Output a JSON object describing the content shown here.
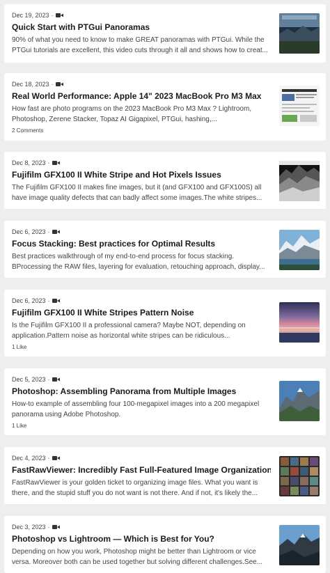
{
  "posts": [
    {
      "date": "Dec 19, 2023",
      "title": "Quick Start with PTGui Panoramas",
      "excerpt_line1": "90% of what you need to know to make GREAT panoramas with PTGui.  While the",
      "excerpt_line2": "PTGui tutorials are excellent, this video cuts through it all and shows how to creat...",
      "footer": ""
    },
    {
      "date": "Dec 18, 2023",
      "title": "Real World Performance: Apple 14\" 2023 MacBook Pro M3 Max",
      "excerpt_line1": "How fast are photo programs on the 2023 MacBook Pro M3 Max ?  Lightroom,",
      "excerpt_line2": "Photoshop, Zerene Stacker, Topaz AI Gigapixel, PTGui, hashing,...",
      "footer": "2 Comments"
    },
    {
      "date": "Dec 8, 2023",
      "title": "Fujifilm GFX100 II White Stripe and Hot Pixels Issues",
      "excerpt_line1": "The Fujifilm GFX100 II makes fine images, but it (and GFX100 and GFX100S) all",
      "excerpt_line2": "have   image quality defects that can badly affect some images.The white stripes...",
      "footer": ""
    },
    {
      "date": "Dec 6, 2023",
      "title": "Focus Stacking: Best practices for Optimal Results",
      "excerpt_line1": "Best practices walkthrough of my end-to-end process for focus stacking.",
      "excerpt_line2": "  BProcessing the RAW files, layering for evaluation, retouching approach, display...",
      "footer": ""
    },
    {
      "date": "Dec 6, 2023",
      "title": "Fujifilm GFX100 II White Stripes Pattern Noise",
      "excerpt_line1": "Is the Fujifilm GFX100 II  a professional camera?  Maybe NOT, depending on",
      "excerpt_line2": "application.Pattern noise  as horizontal white stripes can be ridiculous...",
      "footer": "1 Like"
    },
    {
      "date": "Dec 5, 2023",
      "title": "Photoshop: Assembling Panorama from Multiple Images",
      "excerpt_line1": "How-to example of assembling four 100-megapixel images into a 200 megapixel",
      "excerpt_line2": "panorama using Adobe Photoshop.",
      "footer": "1 Like"
    },
    {
      "date": "Dec 4, 2023",
      "title": "FastRawViewer: Incredibly Fast Full-Featured Image Organization",
      "excerpt_line1": "FastRawViewer is your golden ticket to organizing image files.  What you want is",
      "excerpt_line2": "there, and the stupid stuff you do not want is not there.  And if not, it's likely the...",
      "footer": ""
    },
    {
      "date": "Dec 3, 2023",
      "title": "Photoshop vs Lightroom — Which is Best for You?",
      "excerpt_line1": "Depending on how you work, Photoshop might be better than Lightroom or vice",
      "excerpt_line2": "versa.  Moreover both can be used together but solving different challenges.See...",
      "footer": ""
    }
  ],
  "meta_separator": "·",
  "icons": {
    "video": "video-camera-icon"
  },
  "colors": {
    "background": "#eeeeee",
    "card": "#ffffff",
    "title": "#1a1a1a",
    "text": "#444444"
  }
}
